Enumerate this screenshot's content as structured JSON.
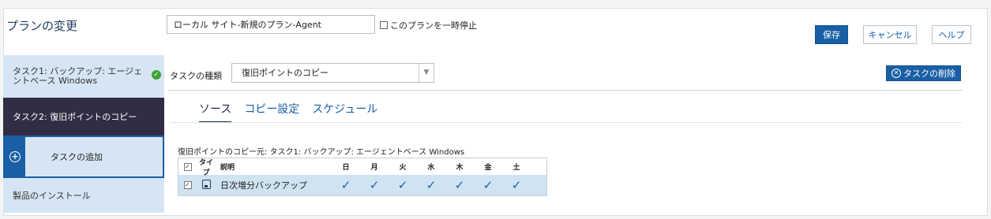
{
  "header": {
    "title": "プランの変更",
    "plan_name_value": "ローカル サイト-新規のプラン-Agent",
    "pause_label": "このプランを一時停止",
    "save_label": "保存",
    "cancel_label": "キャンセル",
    "help_label": "ヘルプ"
  },
  "sidebar": {
    "items": [
      {
        "label": "タスク1: バックアップ: エージェントベース Windows",
        "status_icon": "check-circle-icon",
        "status_color": "#3fa339"
      },
      {
        "label": "タスク2: 復旧ポイントのコピー"
      },
      {
        "label": "タスクの追加",
        "icon": "plus-circle-icon"
      },
      {
        "label": "製品のインストール"
      }
    ]
  },
  "task": {
    "type_label": "タスクの種類",
    "type_value": "復旧ポイントのコピー",
    "delete_label": "タスクの削除",
    "tabs": [
      {
        "label": "ソース",
        "active": true
      },
      {
        "label": "コピー設定",
        "active": false
      },
      {
        "label": "スケジュール",
        "active": false
      }
    ]
  },
  "source": {
    "label": "復旧ポイントのコピー元: タスク1: バックアップ: エージェントベース Windows",
    "columns": {
      "type": "タイプ",
      "desc": "説明",
      "days": [
        "日",
        "月",
        "火",
        "水",
        "木",
        "金",
        "土"
      ]
    },
    "rows": [
      {
        "checked": true,
        "type_icon": "disk-icon",
        "desc": "日次増分バックアップ",
        "days": [
          true,
          true,
          true,
          true,
          true,
          true,
          true
        ]
      }
    ]
  },
  "colors": {
    "accent": "#1a5fa6",
    "selected_nav": "#322d44",
    "nav_bg": "#d6e5f3",
    "row_selected": "#cfe3f1"
  }
}
